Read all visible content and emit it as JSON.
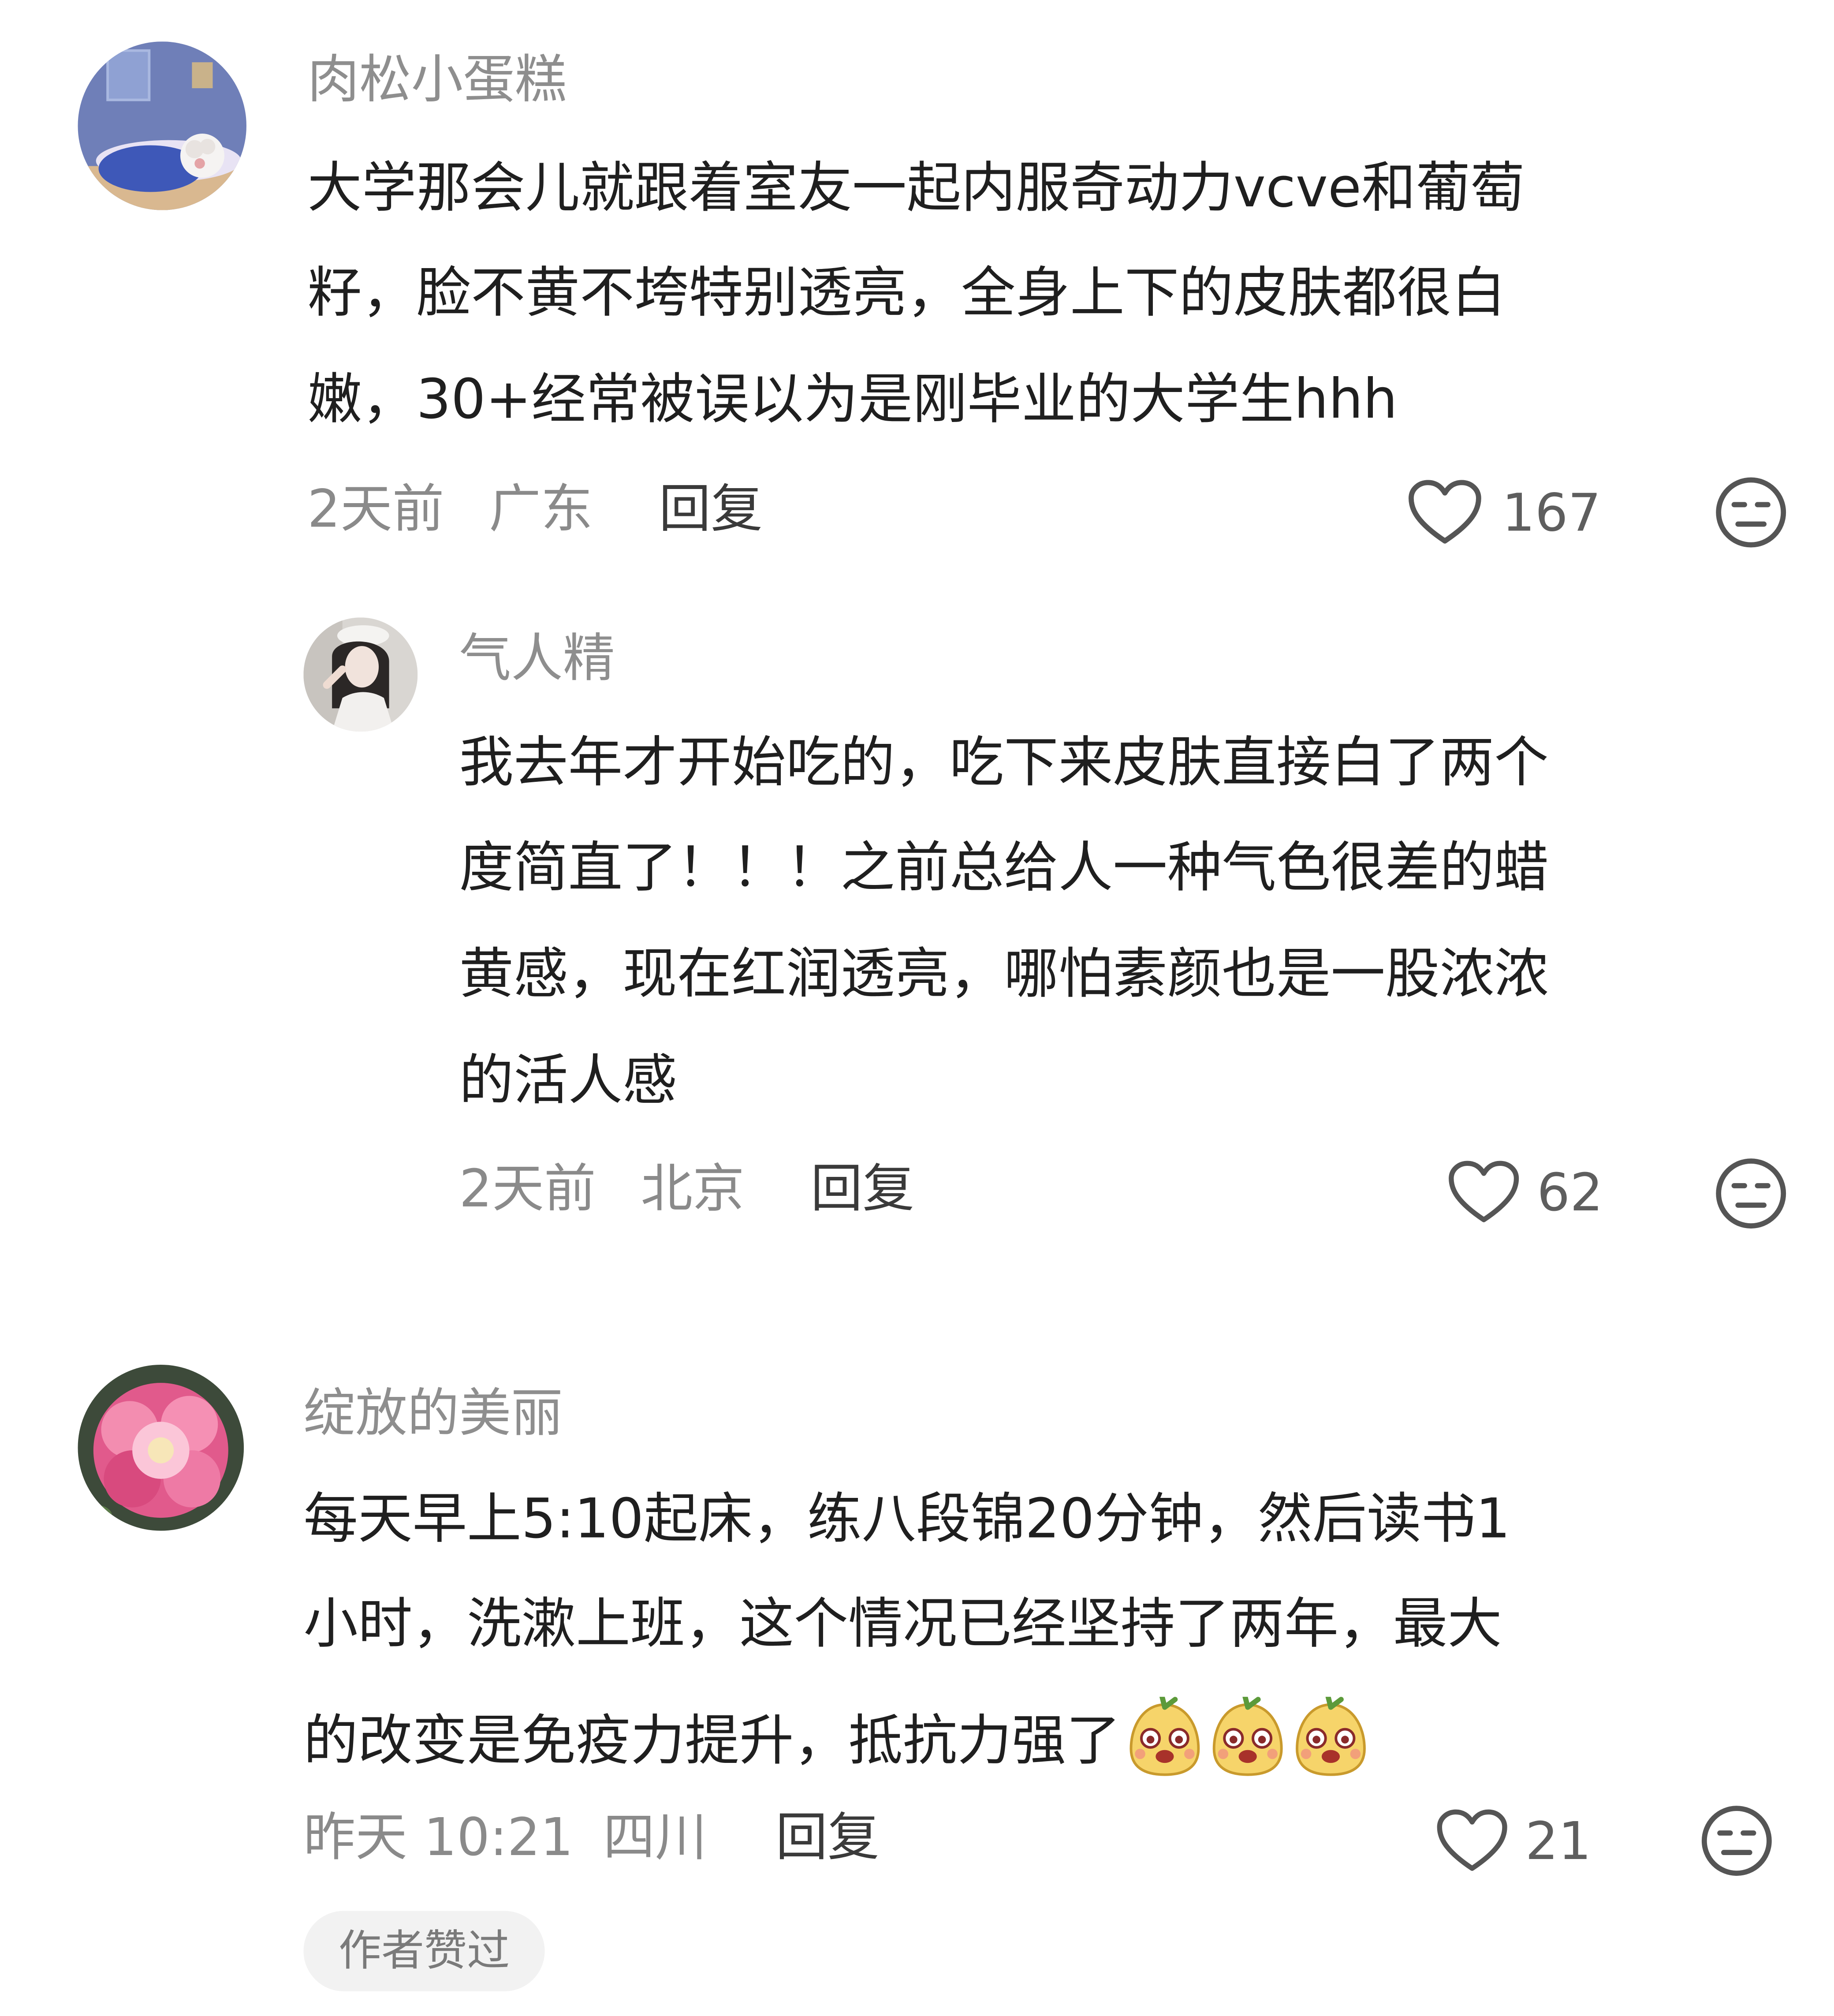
{
  "comments": [
    {
      "username": "肉松小蛋糕",
      "text_lines": [
        "大学那会儿就跟着室友一起内服奇动力vcve和葡萄",
        "籽，脸不黄不垮特别透亮，全身上下的皮肤都很白",
        "嫩，30+经常被误以为是刚毕业的大学生hhh"
      ],
      "time": "2天前",
      "location": "广东",
      "reply_label": "回复",
      "likes": "167",
      "replies": [
        {
          "username": "气人精",
          "text_lines": [
            "我去年才开始吃的，吃下来皮肤直接白了两个",
            "度简直了！！！之前总给人一种气色很差的蜡",
            "黄感，现在红润透亮，哪怕素颜也是一股浓浓",
            "的活人感"
          ],
          "time": "2天前",
          "location": "北京",
          "reply_label": "回复",
          "likes": "62"
        }
      ]
    },
    {
      "username": "绽放的美丽",
      "text_lines": [
        "每天早上5:10起床，练八段锦20分钟，然后读书1",
        "小时，洗漱上班，这个情况已经坚持了两年，最大",
        "的改变是免疫力提升，抵抗力强了"
      ],
      "time": "昨天 10:21",
      "location": "四川",
      "reply_label": "回复",
      "likes": "21",
      "author_badge": "作者赞过"
    }
  ],
  "icons": {
    "like": "heart-outline-icon",
    "dislike": "neutral-face-icon",
    "emoji": "cute-face-emoji-icon"
  },
  "colors": {
    "text_primary": "#1f1f1f",
    "text_secondary": "#8a8a8a",
    "badge_bg": "#f2f2f2"
  }
}
